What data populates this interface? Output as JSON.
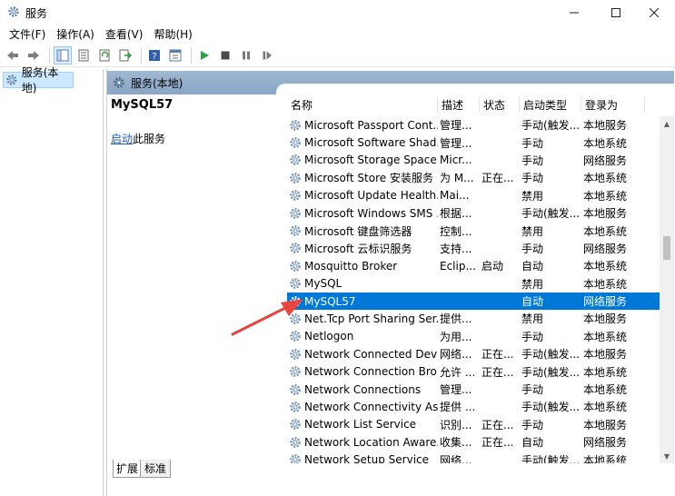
{
  "window": {
    "title": "服务"
  },
  "menu": [
    "文件(F)",
    "操作(A)",
    "查看(V)",
    "帮助(H)"
  ],
  "tree": {
    "selected_label": "服务(本地)"
  },
  "panel": {
    "header": "服务(本地)"
  },
  "detail": {
    "service_name": "MySQL57",
    "link_text": "启动",
    "link_suffix": "此服务"
  },
  "columns": {
    "name": "名称",
    "desc": "描述",
    "status": "状态",
    "start_type": "启动类型",
    "logon": "登录为"
  },
  "rows": [
    {
      "name": "Microsoft Passport Cont...",
      "desc": "管理...",
      "status": "",
      "start": "手动(触发...",
      "logon": "本地服务"
    },
    {
      "name": "Microsoft Software Shad...",
      "desc": "管理...",
      "status": "",
      "start": "手动",
      "logon": "本地系统"
    },
    {
      "name": "Microsoft Storage Space...",
      "desc": "Micr...",
      "status": "",
      "start": "手动",
      "logon": "网络服务"
    },
    {
      "name": "Microsoft Store 安装服务",
      "desc": "为 M...",
      "status": "正在...",
      "start": "手动",
      "logon": "本地系统"
    },
    {
      "name": "Microsoft Update Health...",
      "desc": "Mai...",
      "status": "",
      "start": "禁用",
      "logon": "本地系统"
    },
    {
      "name": "Microsoft Windows SMS ...",
      "desc": "根据...",
      "status": "",
      "start": "手动(触发...",
      "logon": "本地服务"
    },
    {
      "name": "Microsoft 键盘筛选器",
      "desc": "控制...",
      "status": "",
      "start": "禁用",
      "logon": "本地系统"
    },
    {
      "name": "Microsoft 云标识服务",
      "desc": "支持...",
      "status": "",
      "start": "手动",
      "logon": "网络服务"
    },
    {
      "name": "Mosquitto Broker",
      "desc": "Eclip...",
      "status": "启动",
      "start": "自动",
      "logon": "本地系统"
    },
    {
      "name": "MySQL",
      "desc": "",
      "status": "",
      "start": "禁用",
      "logon": "本地系统"
    },
    {
      "name": "MySQL57",
      "desc": "",
      "status": "",
      "start": "自动",
      "logon": "网络服务"
    },
    {
      "name": "Net.Tcp Port Sharing Ser...",
      "desc": "提供...",
      "status": "",
      "start": "禁用",
      "logon": "本地服务"
    },
    {
      "name": "Netlogon",
      "desc": "为用...",
      "status": "",
      "start": "手动",
      "logon": "本地系统"
    },
    {
      "name": "Network Connected Devi...",
      "desc": "网络...",
      "status": "正在...",
      "start": "手动(触发...",
      "logon": "本地服务"
    },
    {
      "name": "Network Connection Bro...",
      "desc": "允许 ...",
      "status": "正在...",
      "start": "手动(触发...",
      "logon": "本地系统"
    },
    {
      "name": "Network Connections",
      "desc": "管理...",
      "status": "",
      "start": "手动",
      "logon": "本地系统"
    },
    {
      "name": "Network Connectivity Ass...",
      "desc": "提供 ...",
      "status": "",
      "start": "手动(触发...",
      "logon": "本地系统"
    },
    {
      "name": "Network List Service",
      "desc": "识别...",
      "status": "正在...",
      "start": "手动",
      "logon": "本地服务"
    },
    {
      "name": "Network Location Aware...",
      "desc": "收集...",
      "status": "正在...",
      "start": "自动",
      "logon": "网络服务"
    },
    {
      "name": "Network Setup Service",
      "desc": "网络...",
      "status": "",
      "start": "手动(触发...",
      "logon": "本地系统"
    }
  ],
  "selected_row": "MySQL57",
  "tabs": [
    "扩展",
    "标准"
  ],
  "colors": {
    "selection": "#0078d7",
    "header_band": "#9fb8d2",
    "arrow": "#e8453c"
  }
}
